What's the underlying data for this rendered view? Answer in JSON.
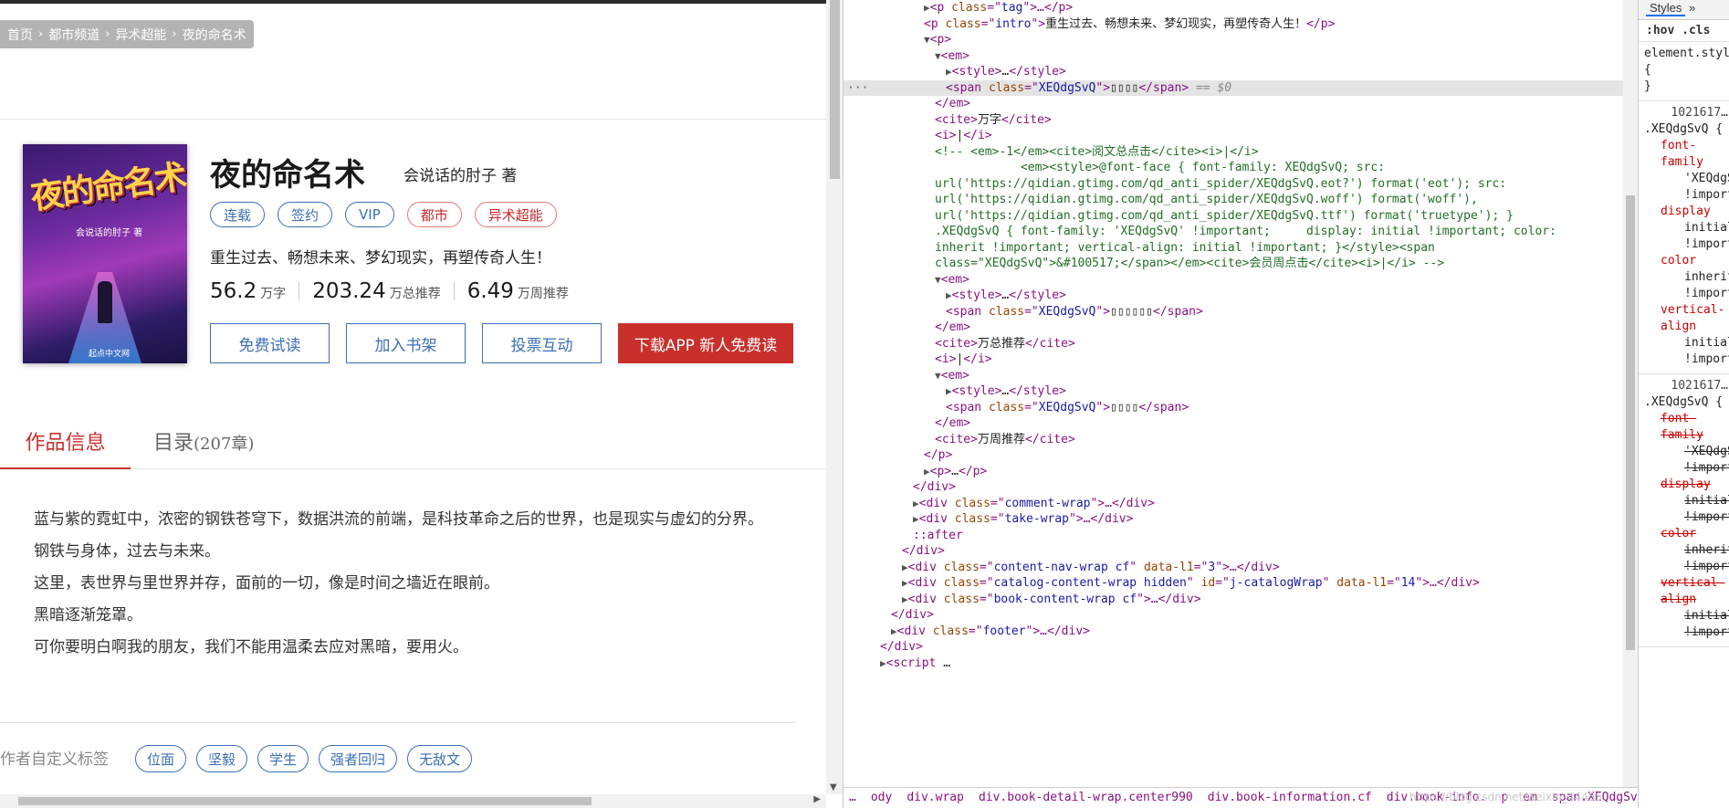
{
  "breadcrumb": [
    "首页",
    "都市频道",
    "异术超能",
    "夜的命名术"
  ],
  "book": {
    "title": "夜的命名术",
    "author": "会说话的肘子 著",
    "cover_title": "夜的命名术",
    "cover_author": "会说话的肘子 著",
    "cover_publisher": "起点中文网",
    "tags": [
      {
        "label": "连载",
        "style": "blue"
      },
      {
        "label": "签约",
        "style": "blue"
      },
      {
        "label": "VIP",
        "style": "blue"
      },
      {
        "label": "都市",
        "style": "red"
      },
      {
        "label": "异术超能",
        "style": "red"
      }
    ],
    "intro": "重生过去、畅想未来、梦幻现实，再塑传奇人生！",
    "stats": [
      {
        "num": "56.2",
        "unit": "万字"
      },
      {
        "num": "203.24",
        "unit": "万总推荐"
      },
      {
        "num": "6.49",
        "unit": "万周推荐"
      }
    ],
    "buttons": {
      "free_read": "免费试读",
      "add_shelf": "加入书架",
      "vote": "投票互动",
      "download": "下载APP 新人免费读"
    }
  },
  "tabs": {
    "info": "作品信息",
    "catalog": "目录",
    "catalog_count": "(207章)"
  },
  "description": [
    "蓝与紫的霓虹中，浓密的钢铁苍穹下，数据洪流的前端，是科技革命之后的世界，也是现实与虚幻的分界。",
    "钢铁与身体，过去与未来。",
    "这里，表世界与里世界并存，面前的一切，像是时间之墙近在眼前。",
    "黑暗逐渐笼罩。",
    "可你要明白啊我的朋友，我们不能用温柔去应对黑暗，要用火。"
  ],
  "custom_tags": {
    "label": "作者自定义标签",
    "items": [
      "位面",
      "坚毅",
      "学生",
      "强者回归",
      "无敌文"
    ]
  },
  "devtools": {
    "lines": [
      [
        {
          "t": "▶",
          "c": "tri"
        },
        {
          "t": "<p ",
          "c": "tg"
        },
        {
          "t": "class",
          "c": "an"
        },
        {
          "t": "=\"",
          "c": "tg"
        },
        {
          "t": "tag",
          "c": "av"
        },
        {
          "t": "\">…</p>",
          "c": "tg"
        }
      ],
      [
        {
          "t": "<p ",
          "c": "tg"
        },
        {
          "t": "class",
          "c": "an"
        },
        {
          "t": "=\"",
          "c": "tg"
        },
        {
          "t": "intro",
          "c": "av"
        },
        {
          "t": "\">",
          "c": "tg"
        },
        {
          "t": "重生过去、畅想未来、梦幻现实，再塑传奇人生！",
          "c": "tx"
        },
        {
          "t": "</p>",
          "c": "tg"
        }
      ],
      [
        {
          "t": "▼",
          "c": "tri"
        },
        {
          "t": "<p>",
          "c": "tg"
        }
      ],
      [
        {
          "t": "▼",
          "c": "tri"
        },
        {
          "t": "<em>",
          "c": "tg"
        }
      ],
      [
        {
          "t": "▶",
          "c": "tri"
        },
        {
          "t": "<style>",
          "c": "tg"
        },
        {
          "t": "…",
          "c": "tx"
        },
        {
          "t": "</style>",
          "c": "tg"
        }
      ],
      [
        {
          "t": "<span ",
          "c": "tg"
        },
        {
          "t": "class",
          "c": "an"
        },
        {
          "t": "=\"",
          "c": "tg"
        },
        {
          "t": "XEQdgSvQ",
          "c": "av"
        },
        {
          "t": "\">",
          "c": "tg"
        },
        {
          "t": "▯▯▯▯",
          "c": "tx"
        },
        {
          "t": "</span>",
          "c": "tg"
        },
        {
          "t": " == $0",
          "c": "eq"
        }
      ],
      [
        {
          "t": "</em>",
          "c": "tg"
        }
      ],
      [
        {
          "t": "<cite>",
          "c": "tg"
        },
        {
          "t": "万字",
          "c": "tx"
        },
        {
          "t": "</cite>",
          "c": "tg"
        }
      ],
      [
        {
          "t": "<i>",
          "c": "tg"
        },
        {
          "t": "|",
          "c": "tx"
        },
        {
          "t": "</i>",
          "c": "tg"
        }
      ],
      [
        {
          "t": "<!-- <em>-1</em><cite>阅文总点击</cite><i>|</i>",
          "c": "cm"
        }
      ],
      [
        {
          "t": "            <em><style>@font-face { font-family: XEQdgSvQ; src:",
          "c": "cm"
        }
      ],
      [
        {
          "t": "url('https://qidian.gtimg.com/qd_anti_spider/XEQdgSvQ.eot?') format('eot'); src:",
          "c": "cm"
        }
      ],
      [
        {
          "t": "url('https://qidian.gtimg.com/qd_anti_spider/XEQdgSvQ.woff') format('woff'),",
          "c": "cm"
        }
      ],
      [
        {
          "t": "url('https://qidian.gtimg.com/qd_anti_spider/XEQdgSvQ.ttf') format('truetype'); }",
          "c": "cm"
        }
      ],
      [
        {
          "t": ".XEQdgSvQ { font-family: 'XEQdgSvQ' !important;     display: initial !important; color:",
          "c": "cm"
        }
      ],
      [
        {
          "t": "inherit !important; vertical-align: initial !important; }</style><span",
          "c": "cm"
        }
      ],
      [
        {
          "t": "class=\"XEQdgSvQ\">&#100517;</span></em><cite>会员周点击</cite><i>|</i> -->",
          "c": "cm"
        }
      ],
      [
        {
          "t": "▼",
          "c": "tri"
        },
        {
          "t": "<em>",
          "c": "tg"
        }
      ],
      [
        {
          "t": "▶",
          "c": "tri"
        },
        {
          "t": "<style>",
          "c": "tg"
        },
        {
          "t": "…",
          "c": "tx"
        },
        {
          "t": "</style>",
          "c": "tg"
        }
      ],
      [
        {
          "t": "<span ",
          "c": "tg"
        },
        {
          "t": "class",
          "c": "an"
        },
        {
          "t": "=\"",
          "c": "tg"
        },
        {
          "t": "XEQdgSvQ",
          "c": "av"
        },
        {
          "t": "\">",
          "c": "tg"
        },
        {
          "t": "▯▯▯▯▯▯",
          "c": "tx"
        },
        {
          "t": "</span>",
          "c": "tg"
        }
      ],
      [
        {
          "t": "</em>",
          "c": "tg"
        }
      ],
      [
        {
          "t": "<cite>",
          "c": "tg"
        },
        {
          "t": "万总推荐",
          "c": "tx"
        },
        {
          "t": "</cite>",
          "c": "tg"
        }
      ],
      [
        {
          "t": "<i>",
          "c": "tg"
        },
        {
          "t": "|",
          "c": "tx"
        },
        {
          "t": "</i>",
          "c": "tg"
        }
      ],
      [
        {
          "t": "▼",
          "c": "tri"
        },
        {
          "t": "<em>",
          "c": "tg"
        }
      ],
      [
        {
          "t": "▶",
          "c": "tri"
        },
        {
          "t": "<style>",
          "c": "tg"
        },
        {
          "t": "…",
          "c": "tx"
        },
        {
          "t": "</style>",
          "c": "tg"
        }
      ],
      [
        {
          "t": "<span ",
          "c": "tg"
        },
        {
          "t": "class",
          "c": "an"
        },
        {
          "t": "=\"",
          "c": "tg"
        },
        {
          "t": "XEQdgSvQ",
          "c": "av"
        },
        {
          "t": "\">",
          "c": "tg"
        },
        {
          "t": "▯▯▯▯",
          "c": "tx"
        },
        {
          "t": "</span>",
          "c": "tg"
        }
      ],
      [
        {
          "t": "</em>",
          "c": "tg"
        }
      ],
      [
        {
          "t": "<cite>",
          "c": "tg"
        },
        {
          "t": "万周推荐",
          "c": "tx"
        },
        {
          "t": "</cite>",
          "c": "tg"
        }
      ],
      [
        {
          "t": "</p>",
          "c": "tg"
        }
      ],
      [
        {
          "t": "▶",
          "c": "tri"
        },
        {
          "t": "<p>",
          "c": "tg"
        },
        {
          "t": "…",
          "c": "tx"
        },
        {
          "t": "</p>",
          "c": "tg"
        }
      ],
      [
        {
          "t": "</div>",
          "c": "tg"
        }
      ],
      [
        {
          "t": "▶",
          "c": "tri"
        },
        {
          "t": "<div ",
          "c": "tg"
        },
        {
          "t": "class",
          "c": "an"
        },
        {
          "t": "=\"",
          "c": "tg"
        },
        {
          "t": "comment-wrap",
          "c": "av"
        },
        {
          "t": "\">…</div>",
          "c": "tg"
        }
      ],
      [
        {
          "t": "▶",
          "c": "tri"
        },
        {
          "t": "<div ",
          "c": "tg"
        },
        {
          "t": "class",
          "c": "an"
        },
        {
          "t": "=\"",
          "c": "tg"
        },
        {
          "t": "take-wrap",
          "c": "av"
        },
        {
          "t": "\">…</div>",
          "c": "tg"
        }
      ],
      [
        {
          "t": "::after",
          "c": "tg"
        }
      ],
      [
        {
          "t": "</div>",
          "c": "tg"
        }
      ],
      [
        {
          "t": "▶",
          "c": "tri"
        },
        {
          "t": "<div ",
          "c": "tg"
        },
        {
          "t": "class",
          "c": "an"
        },
        {
          "t": "=\"",
          "c": "tg"
        },
        {
          "t": "content-nav-wrap cf",
          "c": "av"
        },
        {
          "t": "\" ",
          "c": "tg"
        },
        {
          "t": "data-l1",
          "c": "an"
        },
        {
          "t": "=\"",
          "c": "tg"
        },
        {
          "t": "3",
          "c": "av"
        },
        {
          "t": "\">…</div>",
          "c": "tg"
        }
      ],
      [
        {
          "t": "▶",
          "c": "tri"
        },
        {
          "t": "<div ",
          "c": "tg"
        },
        {
          "t": "class",
          "c": "an"
        },
        {
          "t": "=\"",
          "c": "tg"
        },
        {
          "t": "catalog-content-wrap hidden",
          "c": "av"
        },
        {
          "t": "\" ",
          "c": "tg"
        },
        {
          "t": "id",
          "c": "an"
        },
        {
          "t": "=\"",
          "c": "tg"
        },
        {
          "t": "j-catalogWrap",
          "c": "av"
        },
        {
          "t": "\" ",
          "c": "tg"
        },
        {
          "t": "data-l1",
          "c": "an"
        },
        {
          "t": "=\"",
          "c": "tg"
        },
        {
          "t": "14",
          "c": "av"
        },
        {
          "t": "\">…</div>",
          "c": "tg"
        }
      ],
      [
        {
          "t": "▶",
          "c": "tri"
        },
        {
          "t": "<div ",
          "c": "tg"
        },
        {
          "t": "class",
          "c": "an"
        },
        {
          "t": "=\"",
          "c": "tg"
        },
        {
          "t": "book-content-wrap cf",
          "c": "av"
        },
        {
          "t": "\">…</div>",
          "c": "tg"
        }
      ],
      [
        {
          "t": "</div>",
          "c": "tg"
        }
      ],
      [
        {
          "t": "▶",
          "c": "tri"
        },
        {
          "t": "<div ",
          "c": "tg"
        },
        {
          "t": "class",
          "c": "an"
        },
        {
          "t": "=\"",
          "c": "tg"
        },
        {
          "t": "footer",
          "c": "av"
        },
        {
          "t": "\">…</div>",
          "c": "tg"
        }
      ],
      [
        {
          "t": "</div>",
          "c": "tg"
        }
      ],
      [
        {
          "t": "▶",
          "c": "tri"
        },
        {
          "t": "<script ",
          "c": "tg"
        },
        {
          "t": "…",
          "c": "tx"
        }
      ]
    ],
    "indents": [
      88,
      88,
      88,
      100,
      112,
      112,
      100,
      100,
      100,
      100,
      100,
      100,
      100,
      100,
      100,
      100,
      100,
      100,
      112,
      112,
      100,
      100,
      100,
      100,
      112,
      112,
      100,
      100,
      88,
      88,
      76,
      76,
      76,
      76,
      64,
      64,
      64,
      64,
      52,
      52,
      40,
      40
    ],
    "selected_line": 5,
    "breadcrumb": [
      "ody",
      "div.wrap",
      "div.book-detail-wrap.center990",
      "div.book-information.cf",
      "div.book-info.",
      "p",
      "em",
      "span.XEQdgSvQ"
    ],
    "watermark": "https://blog.csdn.net/weixin_44455"
  },
  "styles_panel": {
    "tab": "Styles",
    "more": "»",
    "filter": ":hov  .cls",
    "element_style": "element.style {",
    "element_style_close": "}",
    "rules": [
      {
        "source": "1021617…",
        "selector": ".XEQdgSvQ {",
        "props": [
          {
            "name": "font-family",
            "value": "'XEQdgSvQ' !important",
            "struck": false
          },
          {
            "name": "display",
            "value": "initial !important",
            "struck": false
          },
          {
            "name": "color",
            "value": "inherit !important",
            "struck": false
          },
          {
            "name": "vertical-align",
            "value": "initial !important",
            "struck": false
          }
        ]
      },
      {
        "source": "1021617…",
        "selector": ".XEQdgSvQ {",
        "props": [
          {
            "name": "font-family",
            "value": "'XEQdgSvQ' !important",
            "struck": true
          },
          {
            "name": "display",
            "value": "initial !important",
            "struck": true
          },
          {
            "name": "color",
            "value": "inherit !important",
            "struck": true
          },
          {
            "name": "vertical-align",
            "value": "initial !important",
            "struck": true
          }
        ]
      }
    ]
  }
}
